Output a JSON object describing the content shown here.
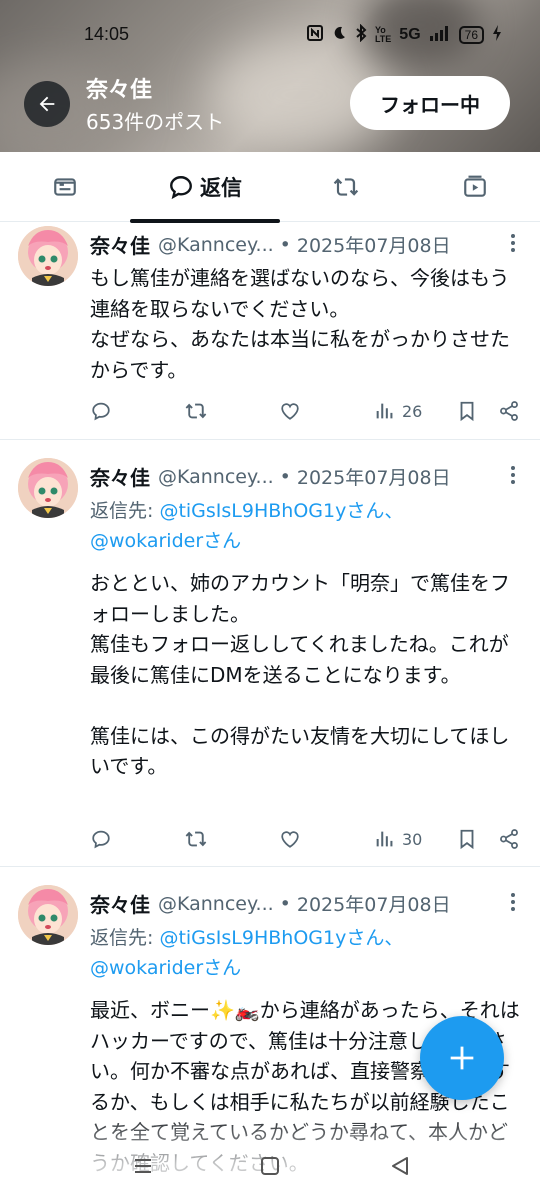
{
  "status_bar": {
    "time": "14:05",
    "icons": [
      "nfc-icon",
      "moon-icon",
      "bluetooth-icon",
      "volte-icon",
      "5g-icon",
      "signal-icon",
      "battery-icon",
      "charging-icon"
    ],
    "network": "5G",
    "battery": "76"
  },
  "header": {
    "profile_name": "奈々佳",
    "post_count": "653件のポスト",
    "follow_button": "フォロー中"
  },
  "tabs": {
    "active_label": "返信",
    "items": [
      "posts-icon",
      "replies",
      "repost-icon",
      "media-icon"
    ]
  },
  "posts": [
    {
      "name": "奈々佳",
      "handle": "@Kanncey...",
      "dot": "•",
      "date": "2025年07月08日",
      "text": "もし篤佳が連絡を選ばないのなら、今後はもう連絡を取らないでください。\nなぜなら、あなたは本当に私をがっかりさせたからです。",
      "views": "26"
    },
    {
      "name": "奈々佳",
      "handle": "@Kanncey...",
      "dot": "•",
      "date": "2025年07月08日",
      "reply_prefix": "返信先: ",
      "reply_link1": "@tiGsIsL9HBhOG1yさん、",
      "reply_link2": "@wokariderさん",
      "text": "おととい、姉のアカウント「明奈」で篤佳をフォローしました。\n篤佳もフォロー返ししてくれましたね。これが最後に篤佳にDMを送ることになります。\n\n篤佳には、この得がたい友情を大切にしてほしいです。",
      "views": "30"
    },
    {
      "name": "奈々佳",
      "handle": "@Kanncey...",
      "dot": "•",
      "date": "2025年07月08日",
      "reply_prefix": "返信先: ",
      "reply_link1": "@tiGsIsL9HBhOG1yさん、",
      "reply_link2": "@wokariderさん",
      "text": "最近、ボニー✨🏍️から連絡があったら、それはハッカーですので、篤佳は十分注意してください。何か不審な点があれば、直接警察に通報するか、もしくは相手に私たちが以前経験したことを全て覚えているかどうか尋ねて、本人かどうか確認してください。"
    }
  ],
  "colors": {
    "accent": "#1d9bf0",
    "text": "#0f1419",
    "secondary": "#536471"
  }
}
